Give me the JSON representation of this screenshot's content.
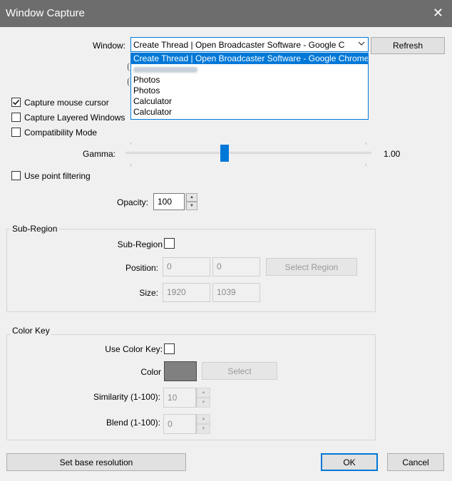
{
  "window": {
    "title": "Window Capture",
    "close_symbol": "✕"
  },
  "capture": {
    "window_label": "Window:",
    "window_value": "Create Thread | Open Broadcaster Software - Google C",
    "refresh_label": "Refresh",
    "dropdown_options": [
      "Create Thread | Open Broadcaster Software - Google Chrome",
      "",
      "Photos",
      "Photos",
      "Calculator",
      "Calculator"
    ],
    "options": {
      "capture_mouse": {
        "label": "Capture mouse cursor",
        "checked": true
      },
      "capture_layered": {
        "label": "Capture Layered Windows",
        "checked": false
      },
      "compatibility": {
        "label": "Compatibility Mode",
        "checked": false
      }
    },
    "gamma_label": "Gamma:",
    "gamma_value": "1.00",
    "gamma_fraction": 0.4,
    "point_filtering_label": "Use point filtering",
    "opacity_label": "Opacity:",
    "opacity_value": "100"
  },
  "sub_region": {
    "group_title": "Sub-Region",
    "toggle_label": "Sub-Region",
    "position_label": "Position:",
    "position_x": "0",
    "position_y": "0",
    "select_region_label": "Select Region",
    "size_label": "Size:",
    "size_w": "1920",
    "size_h": "1039"
  },
  "color_key": {
    "group_title": "Color Key",
    "use_label": "Use Color Key:",
    "color_label": "Color",
    "color_value": "#808080",
    "select_label": "Select",
    "similarity_label": "Similarity (1-100):",
    "similarity_value": "10",
    "blend_label": "Blend (1-100):",
    "blend_value": "0"
  },
  "footer": {
    "base_resolution_label": "Set base resolution",
    "ok_label": "OK",
    "cancel_label": "Cancel"
  },
  "colors": {
    "accent": "#0078d7",
    "titlebar": "#6d6d6d",
    "background": "#f0f0f0"
  }
}
